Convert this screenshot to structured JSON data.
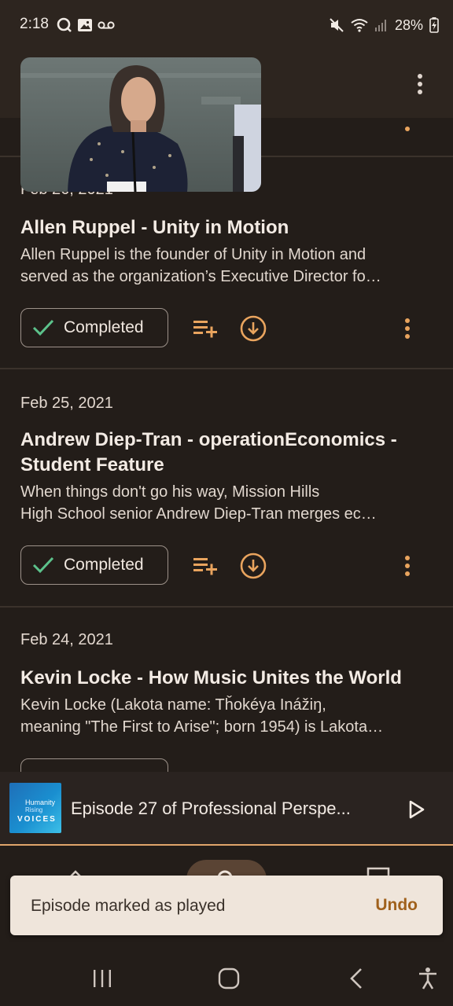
{
  "status_bar": {
    "time": "2:18",
    "battery": "28%"
  },
  "colors": {
    "accent": "#e9a45e",
    "check": "#5cc28b",
    "background": "#231d19",
    "snackbar_action": "#a0611c"
  },
  "episodes": [
    {
      "date": "Feb 26, 2021",
      "title": "Allen Ruppel - Unity in Motion",
      "desc_line1": "Allen Ruppel is the founder of Unity in Motion and",
      "desc_line2": "served as the organization’s Executive Director fo…",
      "status_label": "Completed"
    },
    {
      "date": "Feb 25, 2021",
      "title_line1": "Andrew Diep-Tran - operationEconomics -",
      "title_line2": "Student Feature",
      "desc_line1": "When things don't go his way, Mission Hills",
      "desc_line2": "High School senior Andrew Diep-Tran merges ec…",
      "status_label": "Completed"
    },
    {
      "date": "Feb 24, 2021",
      "title": "Kevin Locke - How Music Unites the World",
      "desc_line1": "Kevin Locke (Lakota name: Tȟokéya Inážiŋ,",
      "desc_line2": "meaning \"The First to Arise\"; born 1954) is Lakota…"
    }
  ],
  "mini_player": {
    "title": "Episode 27 of Professional Perspe...",
    "art_line1": "Humanity",
    "art_line2": "Rising",
    "art_line3": "VOICES"
  },
  "snackbar": {
    "message": "Episode marked as played",
    "action": "Undo"
  },
  "icons": {
    "overflow": "more-vert-icon",
    "queue": "playlist-add-icon",
    "download": "download-circle-icon",
    "check": "check-icon",
    "play": "play-icon"
  }
}
